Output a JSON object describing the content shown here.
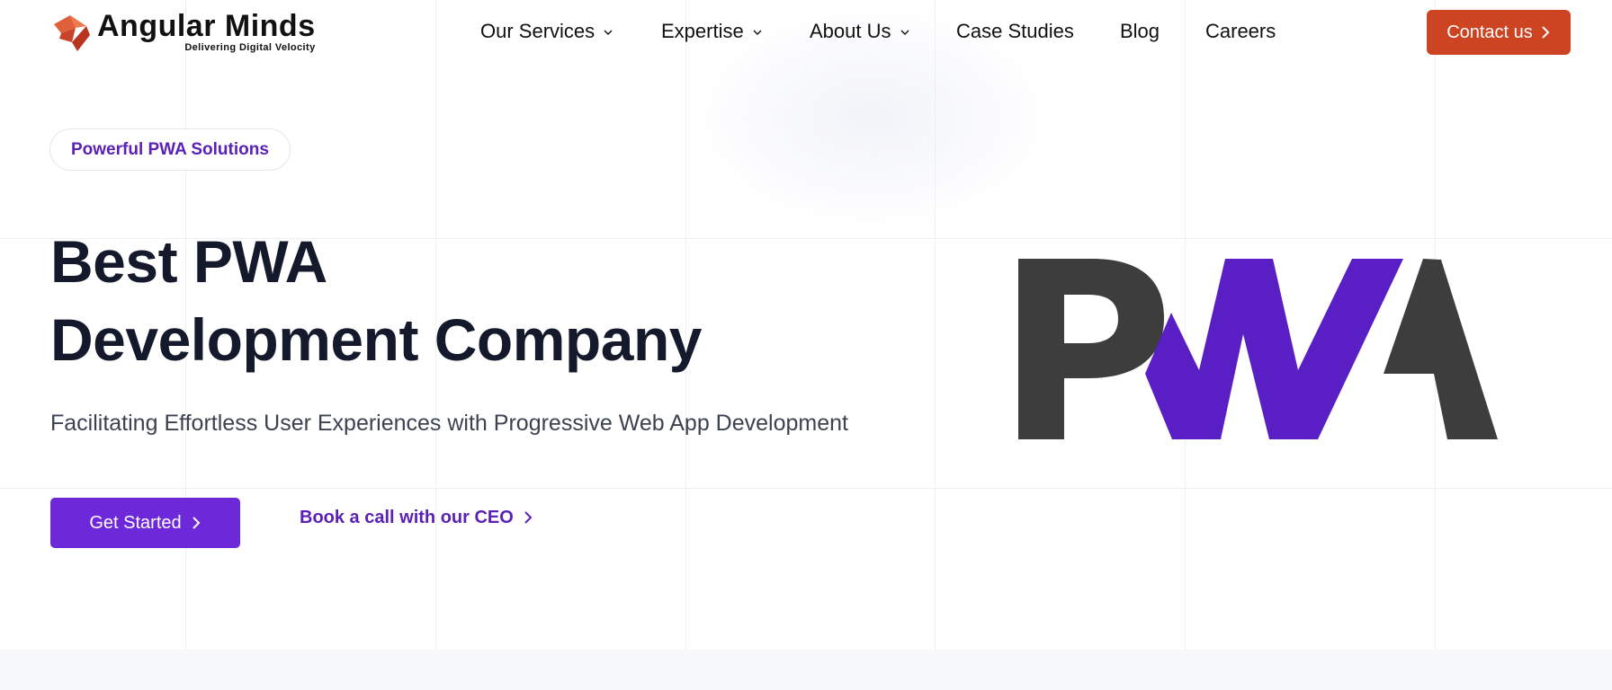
{
  "brand": {
    "name": "Angular Minds",
    "tagline": "Delivering Digital Velocity",
    "logo_icon": "angular-minds-logo-icon",
    "accent_color": "#cc4422"
  },
  "nav": {
    "items": [
      {
        "label": "Our Services",
        "has_dropdown": true
      },
      {
        "label": "Expertise",
        "has_dropdown": true
      },
      {
        "label": "About Us",
        "has_dropdown": true
      },
      {
        "label": "Case Studies",
        "has_dropdown": false
      },
      {
        "label": "Blog",
        "has_dropdown": false
      },
      {
        "label": "Careers",
        "has_dropdown": false
      }
    ],
    "contact_label": "Contact us",
    "contact_icon": "chevron-right-icon"
  },
  "hero": {
    "badge": "Powerful PWA Solutions",
    "title_line1": "Best PWA",
    "title_line2": "Development Company",
    "subtitle": "Facilitating Effortless User Experiences with Progressive Web App Development",
    "cta_primary": "Get Started",
    "cta_secondary": "Book a call with our CEO",
    "primary_color": "#6d28d9",
    "logo_graphic": "pwa-logo",
    "logo_colors": {
      "dark": "#3d3d3d",
      "purple": "#5a1fc4"
    }
  }
}
